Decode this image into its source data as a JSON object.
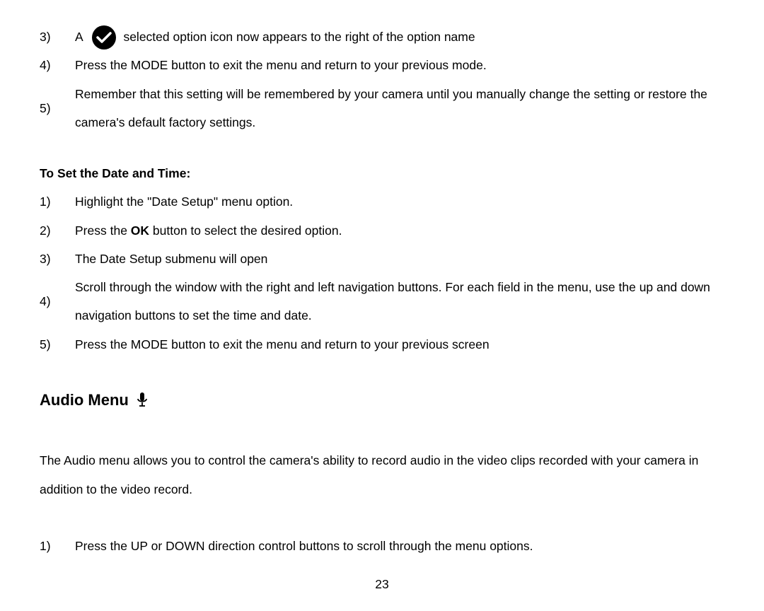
{
  "list_a": [
    {
      "marker": "3)",
      "pre": "A ",
      "post": "selected option icon now appears to the right of the option name"
    },
    {
      "marker": "4)",
      "text": "Press the MODE button to exit the menu and return to your previous mode."
    },
    {
      "marker": "5)",
      "text": "Remember that this setting will be remembered by your camera until you manually change the setting or restore the camera's default factory settings."
    }
  ],
  "subheading": "To Set the Date and Time:",
  "list_b": [
    {
      "marker": "1)",
      "text": "Highlight the \"Date Setup\" menu option."
    },
    {
      "marker": "2)",
      "pre": "Press the ",
      "bold": "OK",
      "post": " button to select the desired option."
    },
    {
      "marker": "3)",
      "text": "The Date Setup submenu will open"
    },
    {
      "marker": "4)",
      "text": "Scroll through the window with the right and left navigation buttons. For each field in the menu, use the up and down navigation buttons to set the time and date."
    },
    {
      "marker": "5)",
      "text": "Press the MODE button to exit the menu and return to your previous screen"
    }
  ],
  "section_title": "Audio Menu",
  "para": "The Audio menu allows you to control the camera's ability to record audio in the video clips recorded with your camera in addition to the video record.",
  "list_c": [
    {
      "marker": "1)",
      "text": "Press the UP or DOWN direction control buttons to scroll through the menu options."
    }
  ],
  "page_number": "23"
}
